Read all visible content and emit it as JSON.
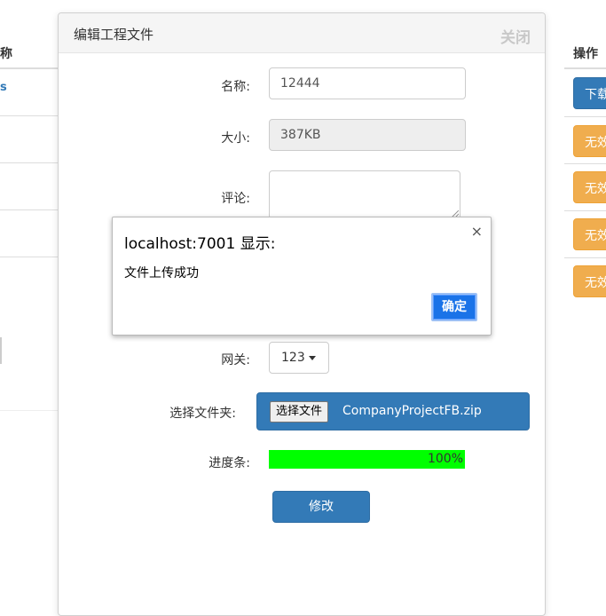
{
  "background_table": {
    "left_header": "称",
    "left_row_mark": "s",
    "right_header": "操作",
    "right_buttons": [
      "下载",
      "无效",
      "无效",
      "无效",
      "无效"
    ]
  },
  "modal": {
    "title": "编辑工程文件",
    "close_label": "关闭",
    "fields": {
      "name_label": "名称:",
      "name_value": "12444",
      "size_label": "大小:",
      "size_value": "387KB",
      "comment_label": "评论:",
      "gateway_label": "网关:",
      "gateway_value": "123",
      "folder_label": "选择文件夹:",
      "file_button": "选择文件",
      "file_name": "CompanyProjectFB.zip",
      "progress_label": "进度条:",
      "progress_text": "100%",
      "progress_percent": 100
    },
    "submit_label": "修改"
  },
  "alert": {
    "title": "localhost:7001 显示:",
    "message": "文件上传成功",
    "ok_label": "确定",
    "close_icon": "×"
  },
  "colors": {
    "primary": "#337ab7",
    "warning": "#f0ad4e",
    "progress": "#00ff00",
    "dialog_button": "#1a73e8"
  }
}
